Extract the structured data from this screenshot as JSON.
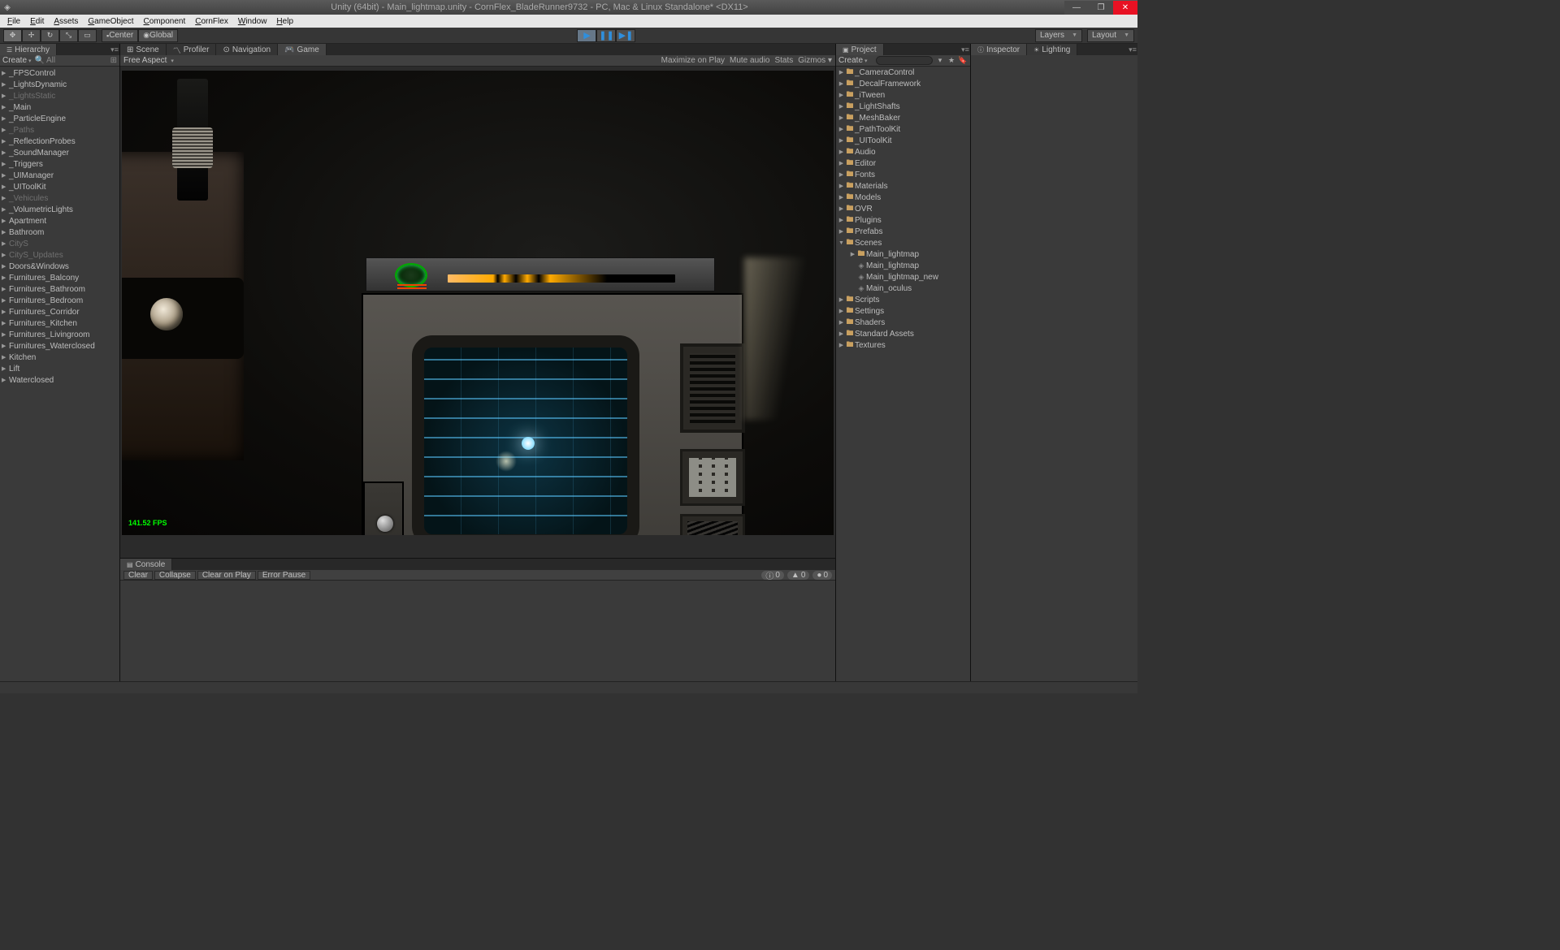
{
  "window": {
    "title": "Unity (64bit) - Main_lightmap.unity - CornFlex_BladeRunner9732 - PC, Mac & Linux Standalone* <DX11>"
  },
  "menus": [
    "File",
    "Edit",
    "Assets",
    "GameObject",
    "Component",
    "CornFlex",
    "Window",
    "Help"
  ],
  "toolbar": {
    "center_label": "Center",
    "global_label": "Global",
    "layers_label": "Layers",
    "layout_label": "Layout"
  },
  "hierarchy": {
    "tab": "Hierarchy",
    "create": "Create",
    "search_placeholder": "All",
    "items": [
      {
        "label": "_FPSControl",
        "dim": false,
        "exp": true
      },
      {
        "label": "_LightsDynamic",
        "dim": false,
        "exp": true
      },
      {
        "label": "_LightsStatic",
        "dim": true,
        "exp": true
      },
      {
        "label": "_Main",
        "dim": false,
        "exp": true
      },
      {
        "label": "_ParticleEngine",
        "dim": false,
        "exp": true
      },
      {
        "label": "_Paths",
        "dim": true,
        "exp": true
      },
      {
        "label": "_ReflectionProbes",
        "dim": false,
        "exp": true
      },
      {
        "label": "_SoundManager",
        "dim": false,
        "exp": true
      },
      {
        "label": "_Triggers",
        "dim": false,
        "exp": true
      },
      {
        "label": "_UIManager",
        "dim": false,
        "exp": true
      },
      {
        "label": "_UIToolKit",
        "dim": false,
        "exp": true
      },
      {
        "label": "_Vehicules",
        "dim": true,
        "exp": true
      },
      {
        "label": "_VolumetricLights",
        "dim": false,
        "exp": true
      },
      {
        "label": "Apartment",
        "dim": false,
        "exp": true
      },
      {
        "label": "Bathroom",
        "dim": false,
        "exp": true
      },
      {
        "label": "CityS",
        "dim": true,
        "exp": true
      },
      {
        "label": "CityS_Updates",
        "dim": true,
        "exp": true
      },
      {
        "label": "Doors&Windows",
        "dim": false,
        "exp": true
      },
      {
        "label": "Furnitures_Balcony",
        "dim": false,
        "exp": true
      },
      {
        "label": "Furnitures_Bathroom",
        "dim": false,
        "exp": true
      },
      {
        "label": "Furnitures_Bedroom",
        "dim": false,
        "exp": true
      },
      {
        "label": "Furnitures_Corridor",
        "dim": false,
        "exp": true
      },
      {
        "label": "Furnitures_Kitchen",
        "dim": false,
        "exp": true
      },
      {
        "label": "Furnitures_Livingroom",
        "dim": false,
        "exp": true
      },
      {
        "label": "Furnitures_Waterclosed",
        "dim": false,
        "exp": true
      },
      {
        "label": "Kitchen",
        "dim": false,
        "exp": true
      },
      {
        "label": "Lift",
        "dim": false,
        "exp": true
      },
      {
        "label": "Waterclosed",
        "dim": false,
        "exp": true
      }
    ]
  },
  "view": {
    "tabs": [
      "Scene",
      "Profiler",
      "Navigation",
      "Game"
    ],
    "active_index": 3,
    "free_aspect": "Free Aspect",
    "maximize": "Maximize on Play",
    "mute": "Mute audio",
    "stats": "Stats",
    "gizmos": "Gizmos",
    "fps": "141.52 FPS"
  },
  "console": {
    "tab": "Console",
    "clear": "Clear",
    "collapse": "Collapse",
    "clear_on_play": "Clear on Play",
    "error_pause": "Error Pause",
    "info_count": "0",
    "warn_count": "0",
    "err_count": "0"
  },
  "project": {
    "tab": "Project",
    "create": "Create",
    "items": [
      {
        "label": "_CameraControl",
        "depth": 0,
        "type": "folder",
        "exp": "right"
      },
      {
        "label": "_DecalFramework",
        "depth": 0,
        "type": "folder",
        "exp": "right"
      },
      {
        "label": "_iTween",
        "depth": 0,
        "type": "folder",
        "exp": "right"
      },
      {
        "label": "_LightShafts",
        "depth": 0,
        "type": "folder",
        "exp": "right"
      },
      {
        "label": "_MeshBaker",
        "depth": 0,
        "type": "folder",
        "exp": "right"
      },
      {
        "label": "_PathToolKit",
        "depth": 0,
        "type": "folder",
        "exp": "right"
      },
      {
        "label": "_UIToolKit",
        "depth": 0,
        "type": "folder",
        "exp": "right"
      },
      {
        "label": "Audio",
        "depth": 0,
        "type": "folder",
        "exp": "right"
      },
      {
        "label": "Editor",
        "depth": 0,
        "type": "folder",
        "exp": "right"
      },
      {
        "label": "Fonts",
        "depth": 0,
        "type": "folder",
        "exp": "right"
      },
      {
        "label": "Materials",
        "depth": 0,
        "type": "folder",
        "exp": "right"
      },
      {
        "label": "Models",
        "depth": 0,
        "type": "folder",
        "exp": "right"
      },
      {
        "label": "OVR",
        "depth": 0,
        "type": "folder",
        "exp": "right"
      },
      {
        "label": "Plugins",
        "depth": 0,
        "type": "folder",
        "exp": "right"
      },
      {
        "label": "Prefabs",
        "depth": 0,
        "type": "folder",
        "exp": "right"
      },
      {
        "label": "Scenes",
        "depth": 0,
        "type": "folder",
        "exp": "down"
      },
      {
        "label": "Main_lightmap",
        "depth": 1,
        "type": "scene-folder",
        "exp": "right"
      },
      {
        "label": "Main_lightmap",
        "depth": 1,
        "type": "scene",
        "exp": ""
      },
      {
        "label": "Main_lightmap_new",
        "depth": 1,
        "type": "scene",
        "exp": ""
      },
      {
        "label": "Main_oculus",
        "depth": 1,
        "type": "scene",
        "exp": ""
      },
      {
        "label": "Scripts",
        "depth": 0,
        "type": "folder",
        "exp": "right"
      },
      {
        "label": "Settings",
        "depth": 0,
        "type": "folder",
        "exp": "right"
      },
      {
        "label": "Shaders",
        "depth": 0,
        "type": "folder",
        "exp": "right"
      },
      {
        "label": "Standard Assets",
        "depth": 0,
        "type": "folder",
        "exp": "right"
      },
      {
        "label": "Textures",
        "depth": 0,
        "type": "folder",
        "exp": "right"
      }
    ]
  },
  "inspector": {
    "tabs": [
      "Inspector",
      "Lighting"
    ]
  }
}
